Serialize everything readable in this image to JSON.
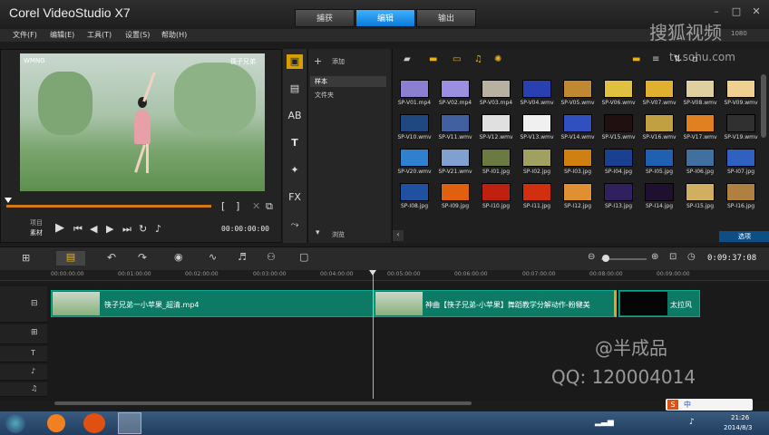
{
  "app": {
    "title": "Corel VideoStudio X7"
  },
  "main_tabs": [
    {
      "label": "捕获"
    },
    {
      "label": "编辑"
    },
    {
      "label": "输出"
    }
  ],
  "menu": [
    "文件(F)",
    "编辑(E)",
    "工具(T)",
    "设置(S)",
    "帮助(H)"
  ],
  "player": {
    "mode_project": "项目",
    "mode_clip": "素材",
    "timecode": "00:00:00:00",
    "video_watermark_left": "WMNG",
    "video_watermark_right": "筷子兄弟"
  },
  "library": {
    "add_label": "添加",
    "folders": [
      "样本",
      "文件夹"
    ],
    "browse_label": "浏览",
    "options_label": "选项",
    "thumbs": [
      "SP-V01.mp4",
      "SP-V02.mp4",
      "SP-V03.mp4",
      "SP-V04.wmv",
      "SP-V05.wmv",
      "SP-V06.wmv",
      "SP-V07.wmv",
      "SP-V08.wmv",
      "SP-V09.wmv",
      "SP-V10.wmv",
      "SP-V11.wmv",
      "SP-V12.wmv",
      "SP-V13.wmv",
      "SP-V14.wmv",
      "SP-V15.wmv",
      "SP-V16.wmv",
      "SP-V17.wmv",
      "SP-V19.wmv",
      "SP-V20.wmv",
      "SP-V21.wmv",
      "SP-I01.jpg",
      "SP-I02.jpg",
      "SP-I03.jpg",
      "SP-I04.jpg",
      "SP-I05.jpg",
      "SP-I06.jpg",
      "SP-I07.jpg",
      "SP-I08.jpg",
      "SP-I09.jpg",
      "SP-I10.jpg",
      "SP-I11.jpg",
      "SP-I12.jpg",
      "SP-I13.jpg",
      "SP-I14.jpg",
      "SP-I15.jpg",
      "SP-I16.jpg"
    ],
    "thumb_colors": [
      "#8a7fd0",
      "#9a8fe0",
      "#b8b0a0",
      "#2840b0",
      "#c08830",
      "#e0c040",
      "#e0b030",
      "#e0d0a0",
      "#f0d090",
      "#204880",
      "#4060a0",
      "#e0e0e0",
      "#f0f0f0",
      "#3050c0",
      "#201010",
      "#c0a040",
      "#e08020",
      "#303030",
      "#3080d0",
      "#80a0d0",
      "#6a7a40",
      "#a0a060",
      "#d08010",
      "#1a4090",
      "#2060b0",
      "#4070a0",
      "#3060c0",
      "#2050a0",
      "#e06010",
      "#c02010",
      "#d03010",
      "#e09030",
      "#302060",
      "#201030",
      "#d0b060",
      "#b08040"
    ]
  },
  "timeline": {
    "total_time": "0:09:37:08",
    "ruler": [
      "00:00:00:00",
      "00:01:00:00",
      "00:02:00:00",
      "00:03:00:00",
      "00:04:00:00",
      "00:05:00:00",
      "00:06:00:00",
      "00:07:00:00",
      "00:08:00:00",
      "00:09:00:00"
    ],
    "clips": [
      {
        "label": "筷子兄弟一小苹果_超清.mp4"
      },
      {
        "label": "神曲【筷子兄弟-小苹果】舞蹈教学分解动作-粉犍美"
      },
      {
        "label": "太拉风"
      }
    ]
  },
  "watermarks": {
    "sohu": "搜狐视频",
    "sohu_url": "tv.sohu.com",
    "author": "@半成品",
    "qq": "QQ: 120004014",
    "partial_code": "1080"
  },
  "taskbar": {
    "time": "21:26",
    "date": "2014/8/3",
    "ime_label": "中"
  }
}
